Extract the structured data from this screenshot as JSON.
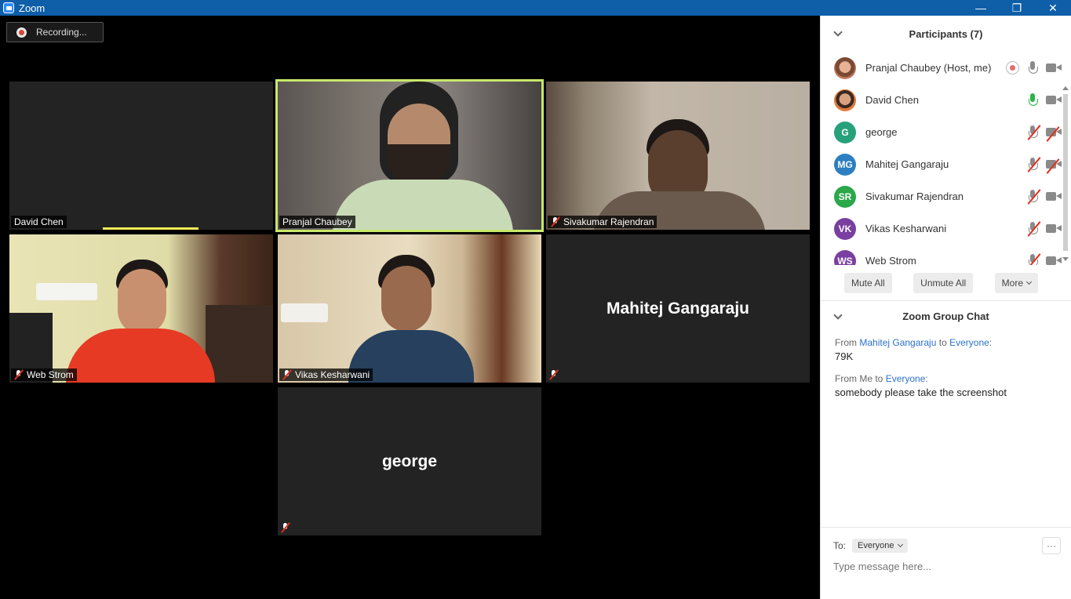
{
  "window": {
    "title": "Zoom",
    "minimize": "—",
    "restore": "❐",
    "close": "✕"
  },
  "recording": {
    "label": "Recording..."
  },
  "tiles": [
    {
      "name": "David Chen"
    },
    {
      "name": "Pranjal Chaubey"
    },
    {
      "name": "Sivakumar Rajendran"
    },
    {
      "name": "Web Strom"
    },
    {
      "name": "Vikas Kesharwani"
    },
    {
      "name": "Mahitej Gangaraju"
    },
    {
      "name": "george"
    }
  ],
  "participants": {
    "header": "Participants (7)",
    "items": [
      {
        "name": "Pranjal Chaubey (Host, me)",
        "initials": "",
        "color": "#c0785a"
      },
      {
        "name": "David Chen",
        "initials": "",
        "color": "#b0705a"
      },
      {
        "name": "george",
        "initials": "G",
        "color": "#26a17b"
      },
      {
        "name": "Mahitej Gangaraju",
        "initials": "MG",
        "color": "#2d7fc1"
      },
      {
        "name": "Sivakumar Rajendran",
        "initials": "SR",
        "color": "#2aa84a"
      },
      {
        "name": "Vikas Kesharwani",
        "initials": "VK",
        "color": "#7a3fa0"
      },
      {
        "name": "Web Strom",
        "initials": "WS",
        "color": "#7a3fa0"
      }
    ],
    "buttons": {
      "mute_all": "Mute All",
      "unmute_all": "Unmute All",
      "more": "More"
    }
  },
  "chat": {
    "header": "Zoom Group Chat",
    "messages": [
      {
        "from_prefix": "From ",
        "from": "Mahitej Gangaraju",
        "to_prefix": " to ",
        "to": "Everyone",
        "suffix": ":",
        "body": "79K"
      },
      {
        "from_prefix": "From Me to ",
        "from": "",
        "to_prefix": "",
        "to": "Everyone",
        "suffix": ":",
        "body": "somebody please take the screenshot"
      }
    ],
    "to_label": "To:",
    "to_value": "Everyone",
    "placeholder": "Type message here...",
    "more": "···"
  },
  "colors": {
    "titlebar": "#0e5ea8",
    "active_speaker": "#c8e86b",
    "link": "#2d72c8"
  }
}
